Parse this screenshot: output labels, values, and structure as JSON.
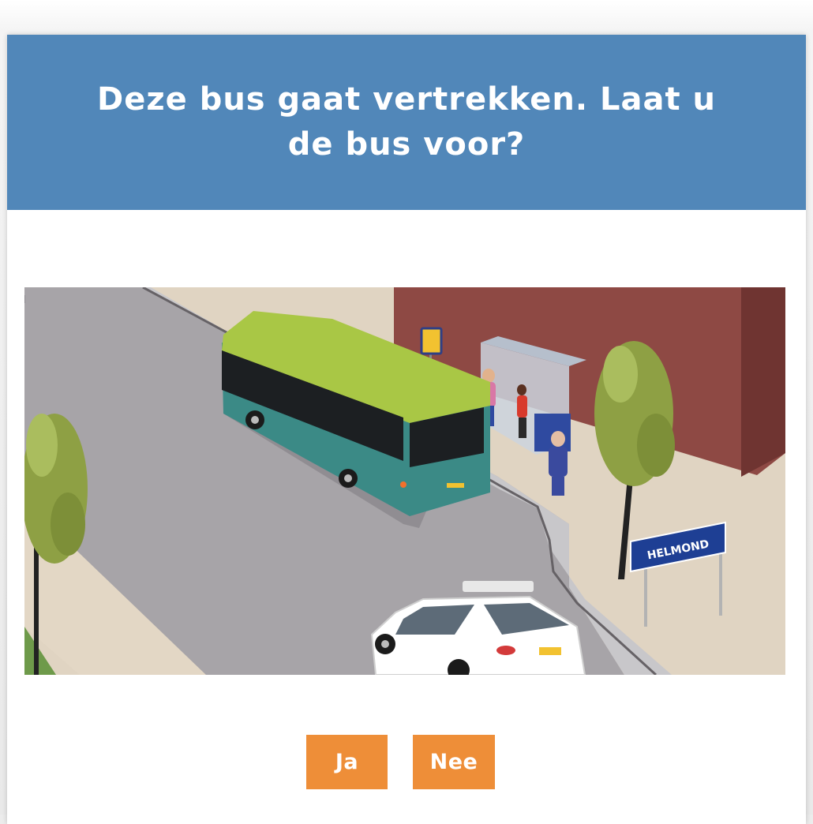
{
  "question": {
    "text": "Deze bus gaat vertrekken. Laat u de bus voor?"
  },
  "scene": {
    "sign_text": "HELMOND"
  },
  "answers": {
    "yes_label": "Ja",
    "no_label": "Nee"
  },
  "colors": {
    "header": "#5187b9",
    "button": "#ee8e38",
    "bus_roof": "#a9c745",
    "bus_body": "#3b8a86",
    "sign": "#1e3f94"
  }
}
